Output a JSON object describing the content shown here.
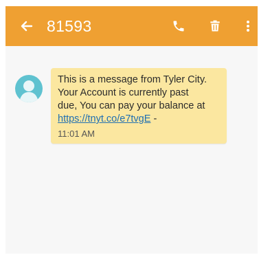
{
  "header": {
    "title": "81593",
    "background_color": "#efa032",
    "icons": [
      "back-arrow-icon",
      "phone-icon",
      "trash-icon",
      "more-vert-icon"
    ]
  },
  "message": {
    "line1": "This is a message from Tyler City.",
    "line2": "Your Account is currently past",
    "line3": "due, You can pay your balance at",
    "link": "https://tnyt.co/e7tvgE",
    "link_suffix": " -",
    "time": "11:01 AM",
    "bubble_color": "#fbe7a0",
    "avatar_color": "#5fc2d0"
  }
}
